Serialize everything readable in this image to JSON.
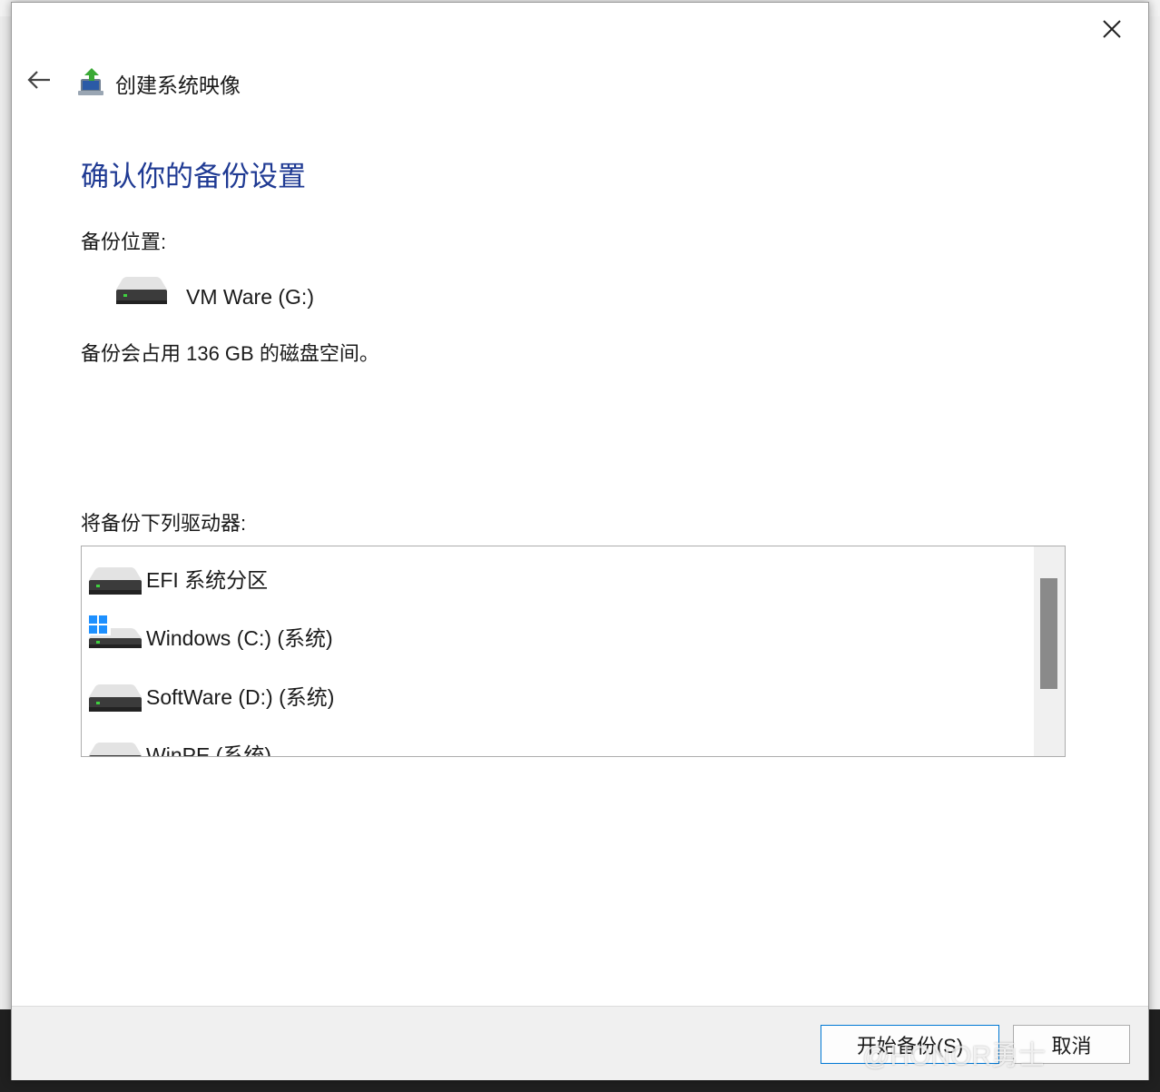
{
  "window": {
    "title": "创建系统映像"
  },
  "main": {
    "heading": "确认你的备份设置",
    "backup_location_label": "备份位置:",
    "backup_location_name": "VM Ware (G:)",
    "space_text": "备份会占用 136 GB 的磁盘空间。",
    "drives_label": "将备份下列驱动器:",
    "drives": [
      {
        "label": "EFI 系统分区",
        "icon": "drive-icon"
      },
      {
        "label": "Windows (C:) (系统)",
        "icon": "windows-drive-icon"
      },
      {
        "label": "SoftWare (D:) (系统)",
        "icon": "drive-icon"
      },
      {
        "label": "WinPE (系统)",
        "icon": "drive-icon"
      }
    ]
  },
  "footer": {
    "start_label": "开始备份(S)",
    "cancel_label": "取消"
  },
  "watermark": "@HONOR勇士",
  "colors": {
    "heading": "#1f3a93",
    "accent": "#0078d4",
    "windows_logo": "#1e90ff",
    "drive_led": "#3fd13f"
  }
}
